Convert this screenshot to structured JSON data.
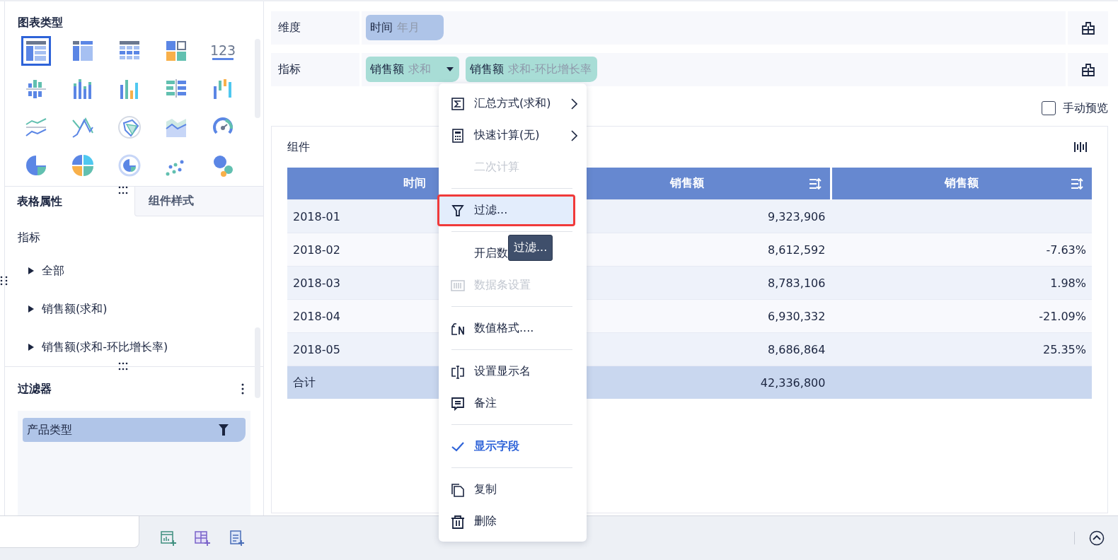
{
  "chart_panel": {
    "title": "图表类型",
    "chart_types": [
      {
        "selected": true
      },
      {
        "selected": false
      },
      {
        "selected": false
      },
      {
        "selected": false
      },
      {
        "selected": false,
        "label": "123"
      },
      {
        "selected": false
      },
      {
        "selected": false
      },
      {
        "selected": false
      },
      {
        "selected": false
      },
      {
        "selected": false
      },
      {
        "selected": false
      },
      {
        "selected": false
      },
      {
        "selected": false
      },
      {
        "selected": false
      },
      {
        "selected": false
      },
      {
        "selected": false
      },
      {
        "selected": false
      },
      {
        "selected": false
      },
      {
        "selected": false
      },
      {
        "selected": false
      }
    ]
  },
  "property_tabs": [
    {
      "label": "表格属性",
      "selected": true
    },
    {
      "label": "组件样式",
      "selected": false
    }
  ],
  "properties": {
    "heading": "指标",
    "items": [
      {
        "label": "全部",
        "expanded": false
      },
      {
        "label": "销售额(求和)",
        "expanded": false
      },
      {
        "label": "销售额(求和-环比增长率)",
        "expanded": false
      }
    ]
  },
  "filter_panel": {
    "title": "过滤器",
    "fields": [
      {
        "label": "产品类型"
      }
    ]
  },
  "dimension_row": {
    "label": "维度",
    "fields": [
      {
        "name": "时间",
        "detail": "年月",
        "dropdown": false
      }
    ]
  },
  "measure_row": {
    "label": "指标",
    "fields": [
      {
        "name": "销售额",
        "detail": "求和",
        "dropdown": true
      },
      {
        "name": "销售额",
        "detail": "求和-环比增长率",
        "dropdown": false
      }
    ]
  },
  "manual_preview": {
    "label": "手动预览",
    "checked": false
  },
  "component": {
    "title": "组件",
    "table": {
      "columns": [
        {
          "label": "时间",
          "kind": "text",
          "sortable": false
        },
        {
          "label": "销售额",
          "kind": "number",
          "sortable": true
        },
        {
          "label": "销售额",
          "kind": "number",
          "sortable": true
        }
      ],
      "rows": [
        [
          "2018-01",
          "9,323,906"
        ],
        [
          "2018-02",
          "8,612,592",
          "-7.63%"
        ],
        [
          "2018-03",
          "8,783,106",
          "1.98%"
        ],
        [
          "2018-04",
          "6,930,332",
          "-21.09%"
        ],
        [
          "2018-05",
          "8,686,864",
          "25.35%"
        ]
      ],
      "total": [
        "合计",
        "42,336,800"
      ]
    }
  },
  "menu": {
    "items": [
      {
        "kind": "item",
        "label": "汇总方式(求和)",
        "submenu": true,
        "disabled": false,
        "selected": false,
        "checked": false
      },
      {
        "kind": "item",
        "label": "快速计算(无)",
        "submenu": true,
        "disabled": false,
        "selected": false,
        "checked": false
      },
      {
        "kind": "item",
        "label": "二次计算",
        "submenu": false,
        "disabled": true,
        "selected": false,
        "checked": false
      },
      {
        "kind": "separator"
      },
      {
        "kind": "item",
        "label": "过滤...",
        "submenu": false,
        "disabled": false,
        "selected": true,
        "checked": false
      },
      {
        "kind": "separator"
      },
      {
        "kind": "item",
        "label": "开启数",
        "submenu": false,
        "disabled": false,
        "selected": false,
        "checked": false
      },
      {
        "kind": "item",
        "label": "数据条设置",
        "submenu": false,
        "disabled": true,
        "selected": false,
        "checked": false
      },
      {
        "kind": "separator"
      },
      {
        "kind": "item",
        "label": "数值格式....",
        "submenu": false,
        "disabled": false,
        "selected": false,
        "checked": false
      },
      {
        "kind": "separator"
      },
      {
        "kind": "item",
        "label": "设置显示名",
        "submenu": false,
        "disabled": false,
        "selected": false,
        "checked": false
      },
      {
        "kind": "item",
        "label": "备注",
        "submenu": false,
        "disabled": false,
        "selected": false,
        "checked": false
      },
      {
        "kind": "separator"
      },
      {
        "kind": "item",
        "label": "显示字段",
        "submenu": false,
        "disabled": false,
        "selected": false,
        "checked": true
      },
      {
        "kind": "separator"
      },
      {
        "kind": "item",
        "label": "复制",
        "submenu": false,
        "disabled": false,
        "selected": false,
        "checked": false
      },
      {
        "kind": "item",
        "label": "删除",
        "submenu": false,
        "disabled": false,
        "selected": false,
        "checked": false
      }
    ]
  },
  "tooltip": {
    "text": "过滤..."
  }
}
